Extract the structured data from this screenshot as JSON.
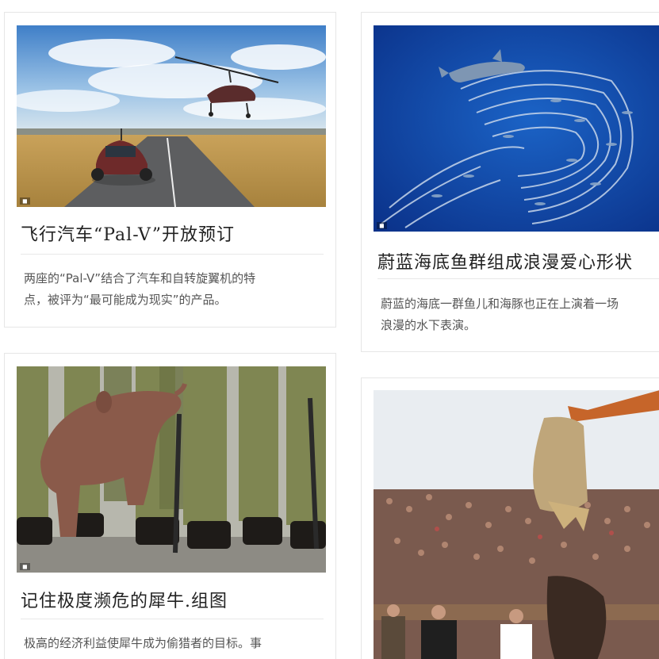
{
  "cards": [
    {
      "title": "飞行汽车“Pal-V”开放预订",
      "desc_line1": "两座的“Pal-V”结合了汽车和自转旋翼机的特",
      "desc_line2": "点，被评为“最可能成为现实”的产品。",
      "image_alt": "flying car on road with rotor aircraft in sky"
    },
    {
      "title": "蔚蓝海底鱼群组成浪漫爱心形状",
      "desc_line1": "蔚蓝的海底一群鱼儿和海豚也正在上演着一场",
      "desc_line2": "浪漫的水下表演。",
      "image_alt": "dolphin swimming with school of fish in blue sea"
    },
    {
      "title": "记住极度濒危的犀牛.组图",
      "desc_line1": "极高的经济利益使犀牛成为偷猎者的目标。事",
      "image_alt": "baby rhino among rangers in uniform"
    },
    {
      "image_alt": "excavator bucket over crowd and bull"
    }
  ]
}
